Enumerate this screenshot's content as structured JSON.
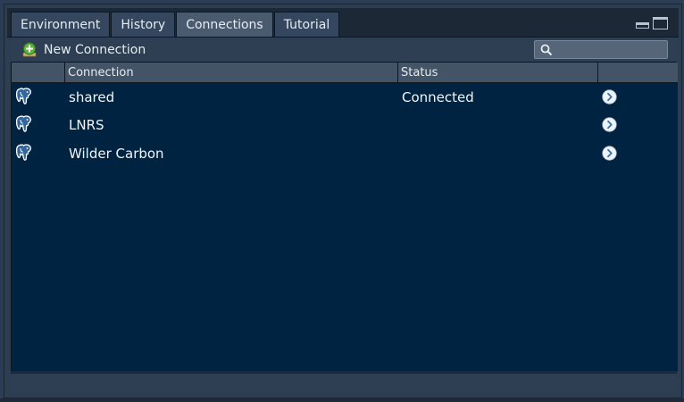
{
  "tabs": [
    {
      "label": "Environment",
      "active": false
    },
    {
      "label": "History",
      "active": false
    },
    {
      "label": "Connections",
      "active": true
    },
    {
      "label": "Tutorial",
      "active": false
    }
  ],
  "toolbar": {
    "new_connection_label": "New Connection",
    "search_placeholder": ""
  },
  "table": {
    "columns": [
      "Connection",
      "Status",
      ""
    ],
    "rows": [
      {
        "name": "shared",
        "status": "Connected",
        "icon": "postgresql-elephant-icon"
      },
      {
        "name": "LNRS",
        "status": "",
        "icon": "postgresql-elephant-icon"
      },
      {
        "name": "Wilder Carbon",
        "status": "",
        "icon": "postgresql-elephant-icon"
      }
    ]
  },
  "colors": {
    "panel_bg": "#002341",
    "header_bg": "#445467",
    "tab_active": "#4a5b70",
    "add_icon_green": "#5fb03a"
  }
}
